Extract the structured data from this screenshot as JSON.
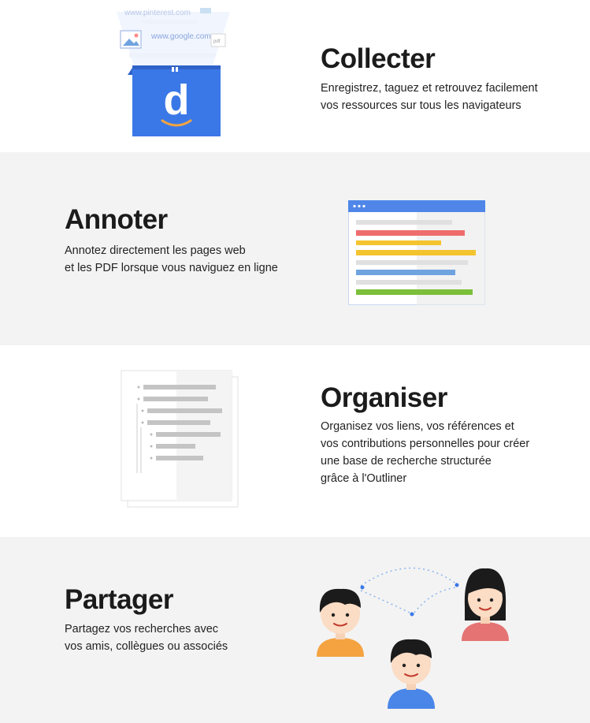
{
  "collect": {
    "title": "Collecter",
    "lines": [
      "Enregistrez, taguez et retrouvez facilement",
      "vos ressources sur tous les navigateurs"
    ],
    "box_letter": "d",
    "floating_urls": [
      "www.pinterest.com",
      "www.google.com"
    ]
  },
  "annotate": {
    "title": "Annoter",
    "lines": [
      "Annotez directement les pages web",
      "et les PDF lorsque vous naviguez en ligne"
    ]
  },
  "organize": {
    "title": "Organiser",
    "lines": [
      "Organisez vos liens, vos références et",
      "vos contributions personnelles pour créer",
      "une base de recherche structurée",
      "grâce à l'Outliner"
    ]
  },
  "share": {
    "title": "Partager",
    "lines": [
      "Partagez vos recherches avec",
      "vos amis, collègues ou associés"
    ]
  },
  "colors": {
    "brand_blue": "#3b78e7",
    "highlight_red": "#ef6c6c",
    "highlight_yellow": "#f4c430",
    "highlight_green": "#7cbf3a",
    "person_orange": "#f4a340",
    "person_pink": "#e57373"
  }
}
